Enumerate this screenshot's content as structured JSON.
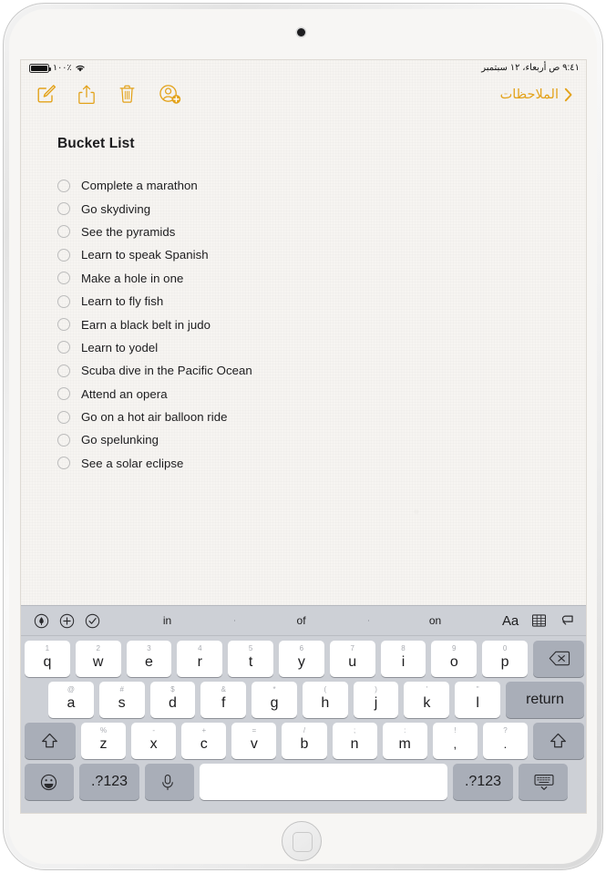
{
  "status_bar": {
    "battery_percent": "١٠٠٪",
    "datetime": "٩:٤١ ص  أربعاء، ١٢ سبتمبر",
    "wifi_icon": "wifi-icon",
    "battery_icon": "battery-icon"
  },
  "navbar": {
    "back_label": "الملاحظات",
    "icons": [
      {
        "name": "compose-icon",
        "label": "Compose"
      },
      {
        "name": "share-icon",
        "label": "Share"
      },
      {
        "name": "trash-icon",
        "label": "Delete"
      },
      {
        "name": "add-person-icon",
        "label": "Add People"
      }
    ]
  },
  "note": {
    "title": "Bucket List",
    "items": [
      {
        "label": "Complete a marathon",
        "checked": false
      },
      {
        "label": "Go skydiving",
        "checked": false
      },
      {
        "label": "See the pyramids",
        "checked": false
      },
      {
        "label": "Learn to speak Spanish",
        "checked": false
      },
      {
        "label": "Make a hole in one",
        "checked": false
      },
      {
        "label": "Learn to fly fish",
        "checked": false
      },
      {
        "label": "Earn a black belt in judo",
        "checked": false
      },
      {
        "label": "Learn to yodel",
        "checked": false
      },
      {
        "label": "Scuba dive in the Pacific Ocean",
        "checked": false
      },
      {
        "label": "Attend an opera",
        "checked": false
      },
      {
        "label": "Go on a hot air balloon ride",
        "checked": false
      },
      {
        "label": "Go spelunking",
        "checked": false
      },
      {
        "label": "See a solar eclipse",
        "checked": false
      }
    ]
  },
  "keyboard": {
    "toolbar": {
      "left_icons": [
        {
          "name": "markup-pen-icon"
        },
        {
          "name": "add-plus-icon"
        },
        {
          "name": "checklist-icon"
        }
      ],
      "predictions": [
        "in",
        "of",
        "on"
      ],
      "right": {
        "format_label": "Aa",
        "table_icon": "table-icon",
        "undo_icon": "undo-icon"
      }
    },
    "rows": [
      [
        {
          "hint": "1",
          "main": "q"
        },
        {
          "hint": "2",
          "main": "w"
        },
        {
          "hint": "3",
          "main": "e"
        },
        {
          "hint": "4",
          "main": "r"
        },
        {
          "hint": "5",
          "main": "t"
        },
        {
          "hint": "6",
          "main": "y"
        },
        {
          "hint": "7",
          "main": "u"
        },
        {
          "hint": "8",
          "main": "i"
        },
        {
          "hint": "9",
          "main": "o"
        },
        {
          "hint": "0",
          "main": "p"
        }
      ],
      [
        {
          "hint": "@",
          "main": "a"
        },
        {
          "hint": "#",
          "main": "s"
        },
        {
          "hint": "$",
          "main": "d"
        },
        {
          "hint": "&",
          "main": "f"
        },
        {
          "hint": "*",
          "main": "g"
        },
        {
          "hint": "(",
          "main": "h"
        },
        {
          "hint": ")",
          "main": "j"
        },
        {
          "hint": "'",
          "main": "k"
        },
        {
          "hint": "\"",
          "main": "l"
        }
      ],
      [
        {
          "hint": "%",
          "main": "z"
        },
        {
          "hint": "-",
          "main": "x"
        },
        {
          "hint": "+",
          "main": "c"
        },
        {
          "hint": "=",
          "main": "v"
        },
        {
          "hint": "/",
          "main": "b"
        },
        {
          "hint": ";",
          "main": "n"
        },
        {
          "hint": ":",
          "main": "m"
        },
        {
          "hint": "!",
          "main": ","
        },
        {
          "hint": "?",
          "main": "."
        }
      ]
    ],
    "return_label": "return",
    "shift_icon": "shift-icon",
    "backspace_icon": "backspace-icon",
    "emoji_label": "emoji-icon",
    "numeric_label": ".?123",
    "numeric_label_right": ".?123",
    "mic_icon": "microphone-icon",
    "space_label": "",
    "dismiss_icon": "dismiss-keyboard-icon"
  },
  "colors": {
    "accent": "#e3a21a",
    "paper": "#f6f4f1",
    "keyboard_bg": "#cdd0d6",
    "key_bg": "#ffffff",
    "fn_key_bg": "#a9aeb8",
    "text": "#1c1c1e"
  }
}
